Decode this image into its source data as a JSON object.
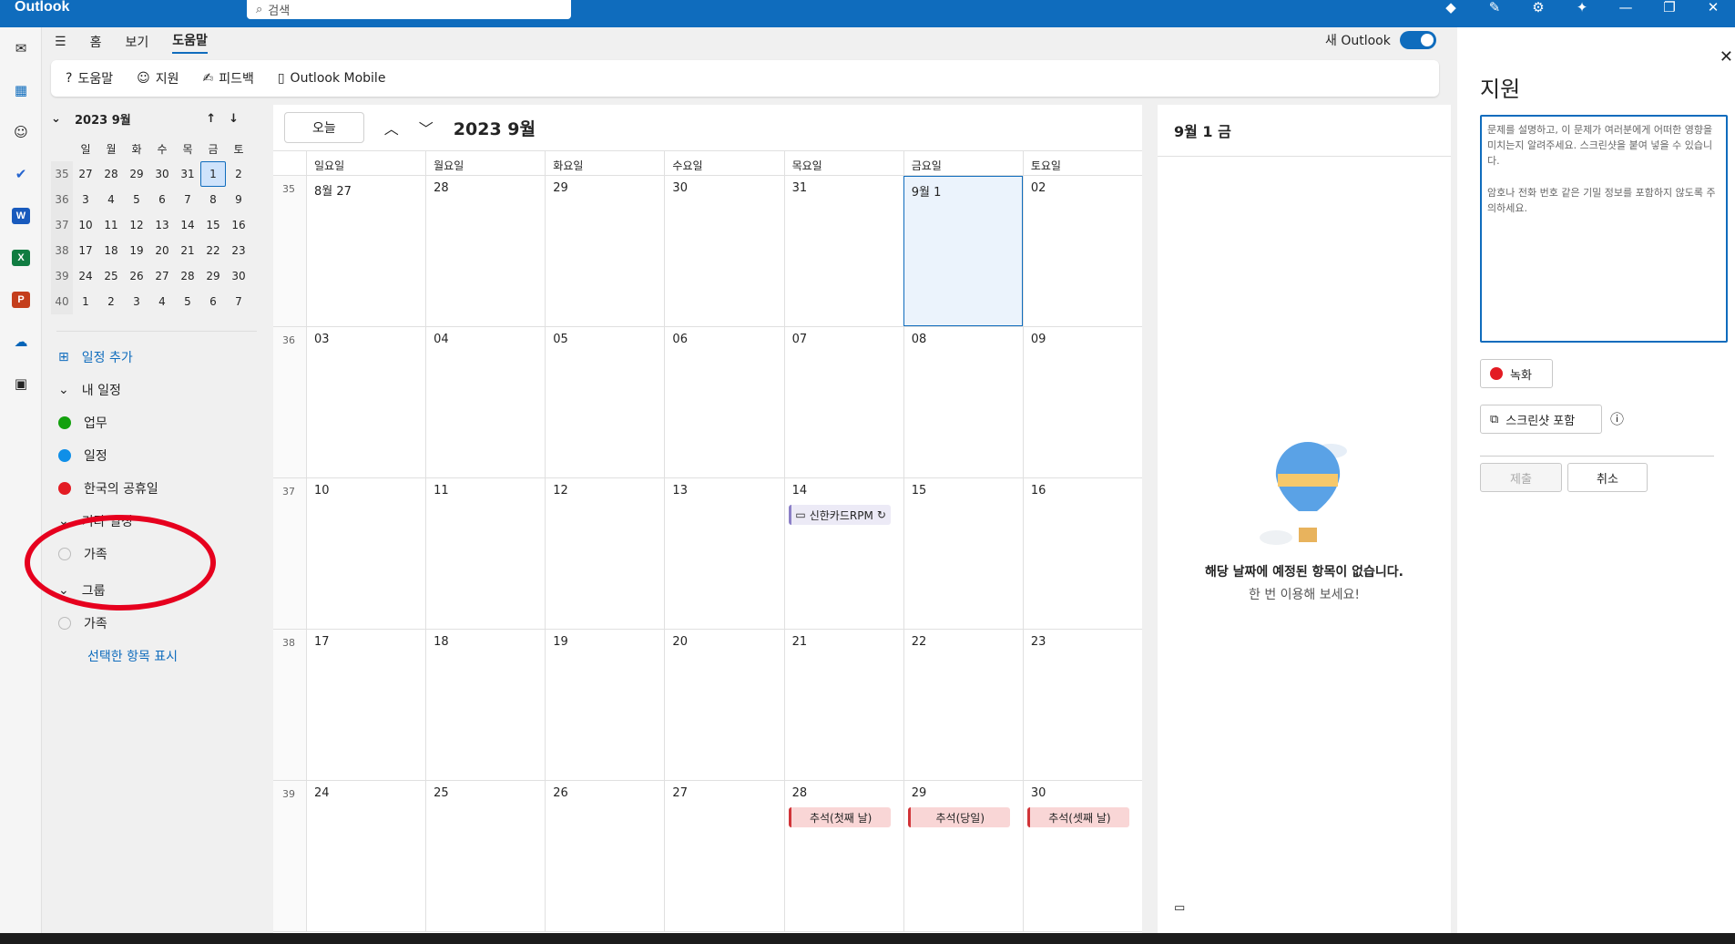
{
  "app": {
    "title": "Outlook",
    "search_placeholder": "검색"
  },
  "tabs": [
    "홈",
    "보기",
    "도움말"
  ],
  "new_outlook": "새 Outlook",
  "ribbon": [
    "도움말",
    "지원",
    "피드백",
    "Outlook Mobile"
  ],
  "mini": {
    "title": "2023 9월",
    "days": [
      "일",
      "월",
      "화",
      "수",
      "목",
      "금",
      "토"
    ],
    "weeks": [
      [
        "35",
        "27",
        "28",
        "29",
        "30",
        "31",
        "1",
        "2"
      ],
      [
        "36",
        "3",
        "4",
        "5",
        "6",
        "7",
        "8",
        "9"
      ],
      [
        "37",
        "10",
        "11",
        "12",
        "13",
        "14",
        "15",
        "16"
      ],
      [
        "38",
        "17",
        "18",
        "19",
        "20",
        "21",
        "22",
        "23"
      ],
      [
        "39",
        "24",
        "25",
        "26",
        "27",
        "28",
        "29",
        "30"
      ],
      [
        "40",
        "1",
        "2",
        "3",
        "4",
        "5",
        "6",
        "7"
      ]
    ]
  },
  "left": {
    "add_event": "일정 추가",
    "my_cal": "내 일정",
    "my_items": [
      "업무",
      "일정",
      "한국의 공휴일"
    ],
    "other_cal": "기타 일정",
    "other_items": [
      "가족"
    ],
    "group": "그룹",
    "group_items": [
      "가족"
    ],
    "show_selected": "선택한 항목 표시"
  },
  "colors": {
    "work": "#13a10e",
    "cal": "#0f8fe8",
    "holiday": "#e31b23"
  },
  "cal": {
    "today_btn": "오늘",
    "month": "2023 9월",
    "dow": [
      "일요일",
      "월요일",
      "화요일",
      "수요일",
      "목요일",
      "금요일",
      "토요일"
    ],
    "weeks": [
      {
        "num": "35",
        "days": [
          "8월 27",
          "28",
          "29",
          "30",
          "31",
          "9월 1",
          "02"
        ]
      },
      {
        "num": "36",
        "days": [
          "03",
          "04",
          "05",
          "06",
          "07",
          "08",
          "09"
        ]
      },
      {
        "num": "37",
        "days": [
          "10",
          "11",
          "12",
          "13",
          "14",
          "15",
          "16"
        ]
      },
      {
        "num": "38",
        "days": [
          "17",
          "18",
          "19",
          "20",
          "21",
          "22",
          "23"
        ]
      },
      {
        "num": "39",
        "days": [
          "24",
          "25",
          "26",
          "27",
          "28",
          "29",
          "30"
        ]
      }
    ],
    "events": {
      "rpm": "신한카드RPM",
      "chuseok1": "추석(첫째 날)",
      "chuseok2": "추석(당일)",
      "chuseok3": "추석(셋째 날)"
    }
  },
  "agenda": {
    "title": "9월 1 금",
    "empty": "해당 날짜에 예정된 항목이 없습니다.",
    "try": "한 번 이용해 보세요!"
  },
  "support": {
    "title": "지원",
    "text1": "문제를 설명하고, 이 문제가 여러분에게 어떠한 영향을 미치는지 알려주세요. 스크린샷을 붙여 넣을 수 있습니다.",
    "text2": "암호나 전화 번호 같은 기밀 정보를 포함하지 않도록 주의하세요.",
    "record": "녹화",
    "screenshot": "스크린샷 포함",
    "submit": "제출",
    "cancel": "취소"
  }
}
